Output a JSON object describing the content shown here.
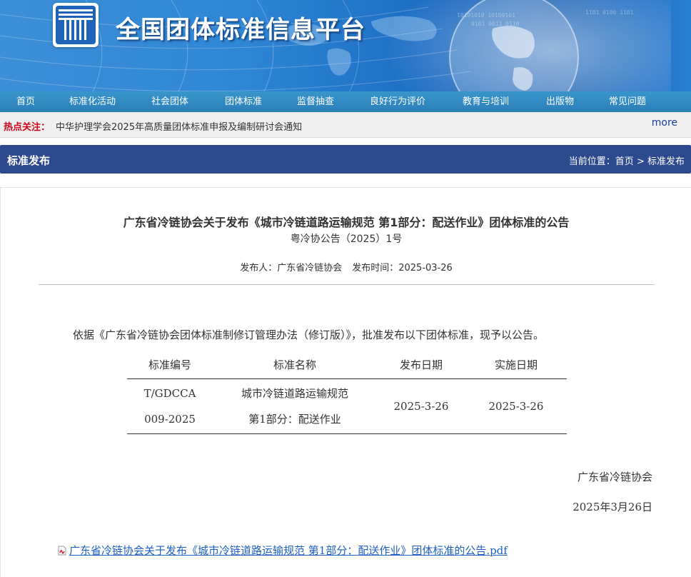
{
  "site": {
    "title": "全国团体标准信息平台"
  },
  "nav": {
    "items": [
      {
        "label": "首页"
      },
      {
        "label": "标准化活动"
      },
      {
        "label": "社会团体"
      },
      {
        "label": "团体标准"
      },
      {
        "label": "监督抽查"
      },
      {
        "label": "良好行为评价"
      },
      {
        "label": "教育与培训"
      },
      {
        "label": "出版物"
      },
      {
        "label": "常见问题"
      }
    ]
  },
  "hot": {
    "label": "热点关注：",
    "link": "中华护理学会2025年高质量团体标准申报及编制研讨会通知",
    "more": "more"
  },
  "section": {
    "title": "标准发布",
    "crumb_prefix": "当前位置：",
    "crumb_home": "首页",
    "crumb_sep": " > ",
    "crumb_current": "标准发布"
  },
  "article": {
    "title": "广东省冷链协会关于发布《城市冷链道路运输规范 第1部分：配送作业》团体标准的公告",
    "subtitle": "粤冷协公告（2025）1号",
    "publisher_label": "发布人：",
    "publisher": "广东省冷链协会",
    "time_label": "发布时间：",
    "time": "2025-03-26",
    "intro": "依据《广东省冷链协会团体标准制修订管理办法（修订版）》，批准发布以下团体标准，现予以公告。",
    "table": {
      "headers": [
        "标准编号",
        "标准名称",
        "发布日期",
        "实施日期"
      ],
      "rows": [
        {
          "code_line1": "T/GDCCA",
          "code_line2": "009-2025",
          "name_line1": "城市冷链道路运输规范",
          "name_line2": "第1部分：配送作业",
          "release_date": "2025-3-26",
          "effective_date": "2025-3-26"
        }
      ]
    },
    "signature_org": "广东省冷链协会",
    "signature_date": "2025年3月26日",
    "attachment": "广东省冷链协会关于发布《城市冷链道路运输规范 第1部分：配送作业》团体标准的公告.pdf"
  }
}
